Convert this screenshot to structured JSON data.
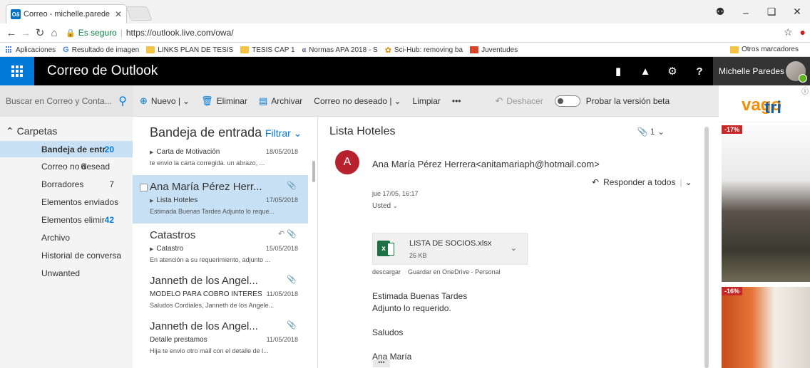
{
  "browser": {
    "tab_title": "Correo - michelle.parede",
    "tab_favicon": "Oā",
    "tab_close": "✕",
    "secure_label": "Es seguro",
    "url": "https://outlook.live.com/owa/"
  },
  "bookmarks": {
    "items": [
      {
        "label": "Aplicaciones",
        "icon": "apps-icon"
      },
      {
        "label": "Resultado de imagen",
        "icon": "google-icon"
      },
      {
        "label": "LINKS PLAN DE TESIS",
        "icon": "folder-icon"
      },
      {
        "label": "TESIS CAP 1",
        "icon": "folder-icon"
      },
      {
        "label": "Normas APA 2018 - S",
        "icon": "apa-icon"
      },
      {
        "label": "Sci-Hub: removing ba",
        "icon": "scihub-icon"
      },
      {
        "label": "Juventudes",
        "icon": "site-icon"
      }
    ],
    "other": "Otros marcadores"
  },
  "header": {
    "app_name": "Correo de Outlook",
    "user_name": "Michelle Paredes"
  },
  "search": {
    "placeholder": "Buscar en Correo y Conta..."
  },
  "commands": {
    "new": "Nuevo |",
    "delete": "Eliminar",
    "archive": "Archivar",
    "junk": "Correo no deseado |",
    "sweep": "Limpiar",
    "more": "•••",
    "undo": "Deshacer",
    "beta": "Probar la versión beta"
  },
  "folders": {
    "header": "Carpetas",
    "items": [
      {
        "name": "Bandeja de entr",
        "count": "20"
      },
      {
        "name": "Correo no desead",
        "count": "6"
      },
      {
        "name": "Borradores",
        "count": "7"
      },
      {
        "name": "Elementos enviados",
        "count": ""
      },
      {
        "name": "Elementos elimir",
        "count": "42"
      },
      {
        "name": "Archivo",
        "count": ""
      },
      {
        "name": "Historial de conversa",
        "count": ""
      },
      {
        "name": "Unwanted",
        "count": ""
      }
    ]
  },
  "message_list": {
    "title": "Bandeja de entrada",
    "filter": "Filtrar",
    "messages": [
      {
        "from": "",
        "subject": "Carta de Motivación",
        "date": "18/05/2018",
        "preview": "te envio la carta corregida. un abrazo, ..."
      },
      {
        "from": "Ana María Pérez Herr...",
        "subject": "Lista Hoteles",
        "date": "17/05/2018",
        "preview": "Estimada Buenas Tardes Adjunto lo reque..."
      },
      {
        "from": "Catastros",
        "subject": "Catastro",
        "date": "15/05/2018",
        "preview": "En atención a su requerimiento, adjunto ..."
      },
      {
        "from": "Janneth de los Angel...",
        "subject": "MODELO PARA COBRO INTERES",
        "date": "11/05/2018",
        "preview": "Saludos Cordiales, Janneth de los Angele..."
      },
      {
        "from": "Janneth de los Angel...",
        "subject": "Detalle prestamos",
        "date": "11/05/2018",
        "preview": "Hija te envio otro mail con el detalle de l..."
      }
    ]
  },
  "reading": {
    "subject": "Lista Hoteles",
    "attach_count": "1",
    "avatar_letter": "A",
    "sender": "Ana María Pérez Herrera<anitamariaph@hotmail.com>",
    "reply_all": "Responder a todos",
    "date": "jue 17/05, 16:17",
    "to": "Usted",
    "attachment": {
      "name": "LISTA DE SOCIOS.xlsx",
      "size": "26 KB"
    },
    "download": "descargar",
    "save_onedrive": "Guardar en OneDrive - Personal",
    "body": [
      "Estimada Buenas Tardes",
      "Adjunto lo requerido.",
      "",
      "Saludos",
      "",
      "Ana María"
    ],
    "more": "•••"
  },
  "ad": {
    "brand_a": "tri",
    "brand_b": "vago",
    "badge1": "-17%",
    "badge2": "-16%"
  }
}
